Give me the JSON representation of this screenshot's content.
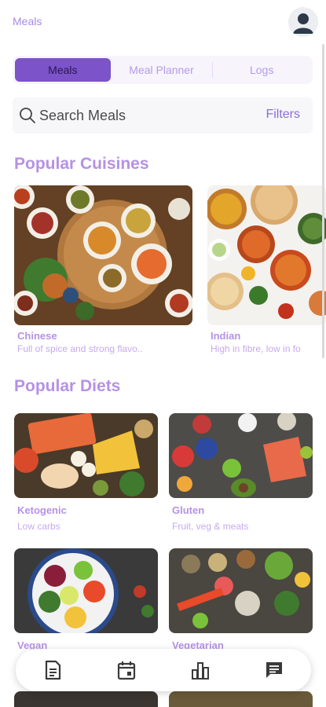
{
  "app": {
    "title": "Meals"
  },
  "tabs": [
    {
      "label": "Meals",
      "active": true
    },
    {
      "label": "Meal Planner",
      "active": false
    },
    {
      "label": "Logs",
      "active": false
    }
  ],
  "search": {
    "placeholder": "Search Meals",
    "filters_label": "Filters"
  },
  "sections": {
    "cuisines_title": "Popular Cuisines",
    "diets_title": "Popular Diets"
  },
  "cuisines": [
    {
      "name": "Chinese",
      "description": "Full of spice and strong flavo.."
    },
    {
      "name": "Indian",
      "description": "High in fibre, low in fo"
    }
  ],
  "diets": [
    {
      "name": "Ketogenic",
      "description": "Low carbs"
    },
    {
      "name": "Gluten",
      "description": "Fruit, veg & meats"
    },
    {
      "name": "Vegan",
      "description": ""
    },
    {
      "name": "Vegetarian",
      "description": ""
    }
  ],
  "bottom_nav": [
    {
      "icon": "meals-list-icon"
    },
    {
      "icon": "calendar-icon"
    },
    {
      "icon": "bar-chart-icon"
    },
    {
      "icon": "chat-icon"
    }
  ],
  "colors": {
    "accent": "#7c53c9",
    "heading": "#b691e5",
    "muted": "#c6aaee"
  }
}
